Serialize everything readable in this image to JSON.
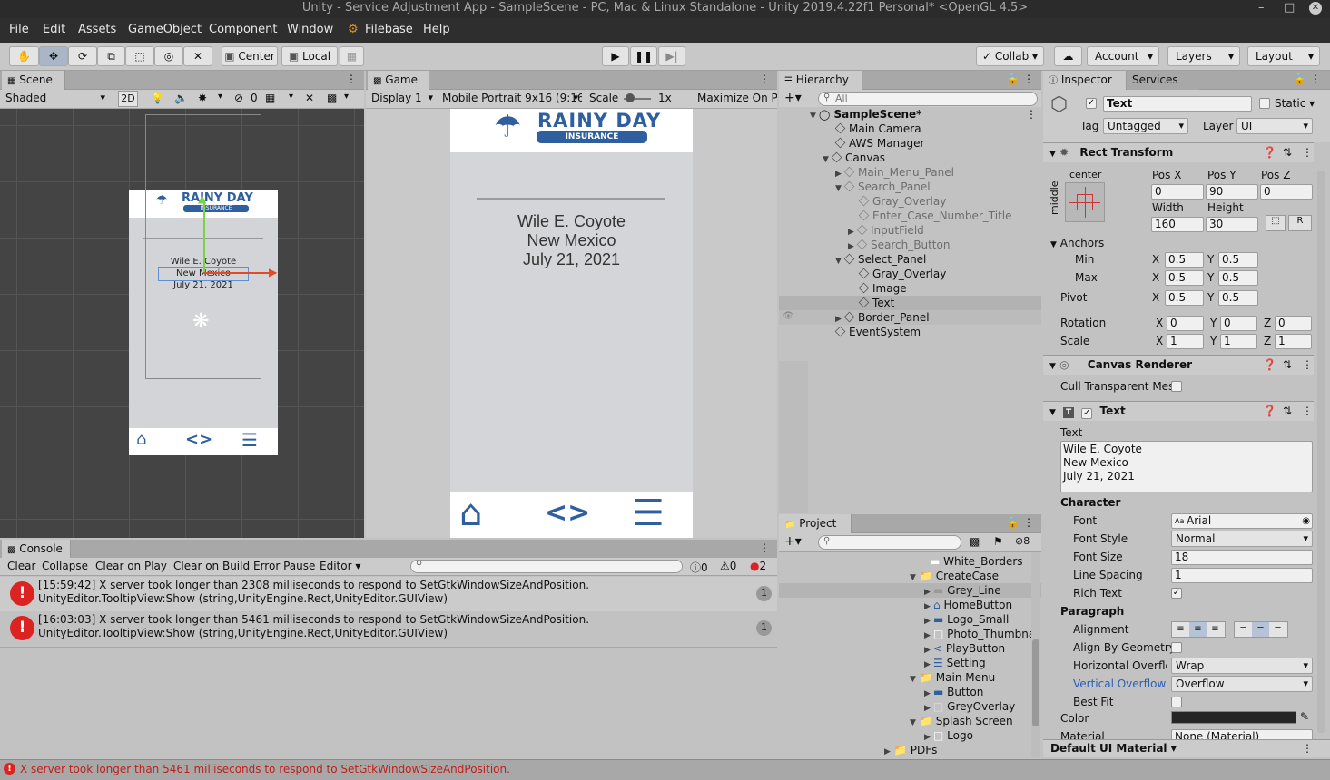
{
  "window": {
    "title": "Unity - Service Adjustment App - SampleScene - PC, Mac & Linux Standalone - Unity 2019.4.22f1 Personal* <OpenGL 4.5>",
    "btn_minimize": "–",
    "btn_maximize": "□",
    "btn_close": "✕"
  },
  "menu": [
    "File",
    "Edit",
    "Assets",
    "GameObject",
    "Component",
    "Window",
    "Filebase",
    "Help"
  ],
  "toolbar": {
    "pivot": "Center",
    "space": "Local",
    "collab": "Collab",
    "account": "Account",
    "layers": "Layers",
    "layout": "Layout"
  },
  "scene": {
    "tab": "Scene",
    "shading": "Shaded",
    "mode2d": "2D",
    "gizmo_count": "0",
    "logo_title": "RAINY DAY",
    "logo_sub": "INSURANCE",
    "lines": [
      "Wile E. Coyote",
      "New Mexico",
      "July 21, 2021"
    ]
  },
  "game": {
    "tab": "Game",
    "display": "Display 1",
    "resolution": "Mobile Portrait 9x16 (9:16",
    "scale_label": "Scale",
    "scale_value": "1x",
    "maximize": "Maximize On Pl",
    "logo_title": "RAINY DAY",
    "logo_sub": "INSURANCE",
    "lines": [
      "Wile E. Coyote",
      "New Mexico",
      "July 21, 2021"
    ]
  },
  "hierarchy": {
    "tab": "Hierarchy",
    "search_placeholder": "All",
    "items": [
      {
        "label": "SampleScene*",
        "bold": true
      },
      {
        "label": "Main Camera"
      },
      {
        "label": "AWS Manager"
      },
      {
        "label": "Canvas"
      },
      {
        "label": "Main_Menu_Panel",
        "dim": true
      },
      {
        "label": "Search_Panel",
        "dim": true
      },
      {
        "label": "Gray_Overlay",
        "dim": true
      },
      {
        "label": "Enter_Case_Number_Title",
        "dim": true
      },
      {
        "label": "InputField",
        "dim": true
      },
      {
        "label": "Search_Button",
        "dim": true
      },
      {
        "label": "Select_Panel"
      },
      {
        "label": "Gray_Overlay"
      },
      {
        "label": "Image"
      },
      {
        "label": "Text",
        "selected": true
      },
      {
        "label": "Border_Panel"
      },
      {
        "label": "EventSystem"
      }
    ]
  },
  "inspector": {
    "tab": "Inspector",
    "tab2": "Services",
    "object_name": "Text",
    "static": "Static",
    "tag_label": "Tag",
    "tag_value": "Untagged",
    "layer_label": "Layer",
    "layer_value": "UI",
    "rect_transform": {
      "title": "Rect Transform",
      "anchor_preset_top": "center",
      "anchor_preset_side": "middle",
      "posx_label": "Pos X",
      "posy_label": "Pos Y",
      "posz_label": "Pos Z",
      "posx": "0",
      "posy": "90",
      "posz": "0",
      "width_label": "Width",
      "height_label": "Height",
      "width": "160",
      "height": "30",
      "anchors": "Anchors",
      "min": "Min",
      "max": "Max",
      "pivot": "Pivot",
      "min_x": "0.5",
      "min_y": "0.5",
      "max_x": "0.5",
      "max_y": "0.5",
      "pivot_x": "0.5",
      "pivot_y": "0.5",
      "rotation": "Rotation",
      "scale": "Scale",
      "rot_x": "0",
      "rot_y": "0",
      "rot_z": "0",
      "scale_x": "1",
      "scale_y": "1",
      "scale_z": "1"
    },
    "canvas_renderer": {
      "title": "Canvas Renderer",
      "cull": "Cull Transparent Mes"
    },
    "text_component": {
      "title": "Text",
      "text_label": "Text",
      "text_lines": [
        "Wile E. Coyote",
        "New Mexico",
        "July 21, 2021"
      ],
      "character": "Character",
      "font_label": "Font",
      "font_value": "Arial",
      "font_style_label": "Font Style",
      "font_style_value": "Normal",
      "font_size_label": "Font Size",
      "font_size_value": "18",
      "line_spacing_label": "Line Spacing",
      "line_spacing_value": "1",
      "rich_text_label": "Rich Text",
      "paragraph": "Paragraph",
      "alignment_label": "Alignment",
      "align_geom_label": "Align By Geometry",
      "horiz_overflow_label": "Horizontal Overflow",
      "horiz_overflow_value": "Wrap",
      "vert_overflow_label": "Vertical Overflow",
      "vert_overflow_value": "Overflow",
      "best_fit_label": "Best Fit",
      "color_label": "Color",
      "material_label": "Material",
      "material_value": "None (Material)"
    },
    "footer_material": "Default UI Material"
  },
  "project": {
    "tab": "Project",
    "hidden_count": "8",
    "items": [
      {
        "label": "White_Borders",
        "indent": 3
      },
      {
        "label": "CreateCase",
        "indent": 2,
        "folder": true
      },
      {
        "label": "Grey_Line",
        "indent": 3,
        "selected": true
      },
      {
        "label": "HomeButton",
        "indent": 3
      },
      {
        "label": "Logo_Small",
        "indent": 3
      },
      {
        "label": "Photo_Thumbna",
        "indent": 3
      },
      {
        "label": "PlayButton",
        "indent": 3
      },
      {
        "label": "Setting",
        "indent": 3
      },
      {
        "label": "Main Menu",
        "indent": 2,
        "folder": true
      },
      {
        "label": "Button",
        "indent": 3
      },
      {
        "label": "GreyOverlay",
        "indent": 3
      },
      {
        "label": "Splash Screen",
        "indent": 2,
        "folder": true
      },
      {
        "label": "Logo",
        "indent": 3
      },
      {
        "label": "PDFs",
        "indent": 1,
        "folder": true
      }
    ]
  },
  "console": {
    "tab": "Console",
    "buttons": [
      "Clear",
      "Collapse",
      "Clear on Play",
      "Clear on Build",
      "Error Pause",
      "Editor"
    ],
    "info_count": "0",
    "warn_count": "0",
    "error_count": "2",
    "entries": [
      {
        "line1": "[15:59:42] X server took longer than 2308 milliseconds to respond to SetGtkWindowSizeAndPosition.",
        "line2": "UnityEditor.TooltipView:Show (string,UnityEngine.Rect,UnityEditor.GUIView)",
        "count": "1"
      },
      {
        "line1": "[16:03:03] X server took longer than 5461 milliseconds to respond to SetGtkWindowSizeAndPosition.",
        "line2": "UnityEditor.TooltipView:Show (string,UnityEngine.Rect,UnityEditor.GUIView)",
        "count": "1"
      }
    ]
  },
  "statusbar": "X server took longer than 5461 milliseconds to respond to SetGtkWindowSizeAndPosition.",
  "colors": {
    "brand_blue": "#2f5f9e",
    "error_red": "#d32222",
    "link_blue": "#2b5fb5"
  }
}
